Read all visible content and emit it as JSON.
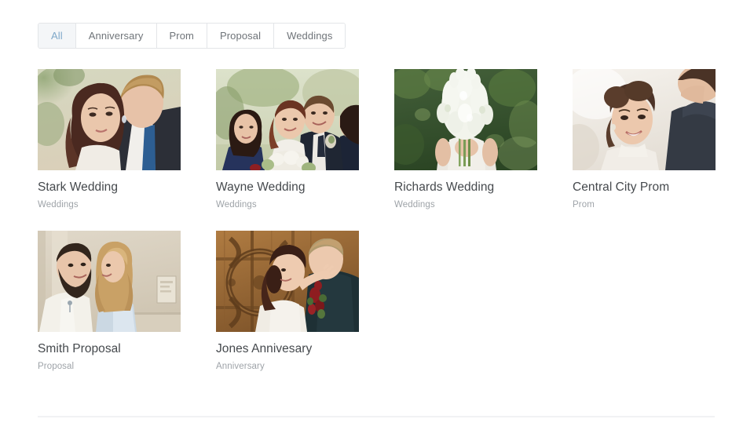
{
  "filters": {
    "tabs": [
      {
        "label": "All",
        "active": true
      },
      {
        "label": "Anniversary",
        "active": false
      },
      {
        "label": "Prom",
        "active": false
      },
      {
        "label": "Proposal",
        "active": false
      },
      {
        "label": "Weddings",
        "active": false
      }
    ]
  },
  "gallery": {
    "items": [
      {
        "title": "Stark Wedding",
        "category": "Weddings",
        "image_alt": "bride-and-groom-close-portrait",
        "colors": {
          "bg_top": "#cfd3bc",
          "bg_bottom": "#d8cdb8",
          "foliage": "#8b9d72",
          "skin": "#e8c4ab",
          "hair_dark": "#4a2a20",
          "hair_light": "#b08a54",
          "suit": "#2d3038",
          "shirt": "#f2f0ec",
          "tie": "#2e5f93"
        }
      },
      {
        "title": "Wayne Wedding",
        "category": "Weddings",
        "image_alt": "wedding-party-group-outdoors",
        "colors": {
          "bg_top": "#d6dcc4",
          "bg_bottom": "#cfd2b6",
          "foliage": "#9aab7e",
          "skin": "#e9c3a6",
          "hair_dark": "#32211b",
          "hair_red": "#7a3f28",
          "suit": "#1f2633",
          "dress_navy": "#26335c",
          "gown": "#f2efe9",
          "bouquet": "#f0ece2"
        }
      },
      {
        "title": "Richards Wedding",
        "category": "Weddings",
        "image_alt": "white-bouquet-held-by-bride",
        "colors": {
          "bg_top": "#3f5a33",
          "bg_bottom": "#2f4a28",
          "foliage": "#4c6b3a",
          "flowers": "#f3f5ee",
          "stems": "#789a55",
          "skin": "#e3bfa4",
          "dress": "#eceae4"
        }
      },
      {
        "title": "Central City Prom",
        "category": "Prom",
        "image_alt": "smiling-woman-with-updo-and-partner",
        "colors": {
          "bg_top": "#f3efe9",
          "bg_bottom": "#e8e2da",
          "skin": "#eac7ad",
          "hair_dark": "#4a3226",
          "suit": "#343a44",
          "dress": "#f0ece6"
        }
      },
      {
        "title": "Smith Proposal",
        "category": "Proposal",
        "image_alt": "couple-kissing-indoors-beige-wall",
        "colors": {
          "bg_top": "#ddd5c5",
          "bg_bottom": "#d2c8b6",
          "skin": "#e9c6ab",
          "hair_dark": "#32251c",
          "hair_blonde": "#c9a166",
          "shirt_white": "#f4f2ec",
          "shirt_blue": "#cbd8e3",
          "panel": "#e6e0d2"
        }
      },
      {
        "title": "Jones Annivesary",
        "category": "Anniversary",
        "image_alt": "couple-embracing-before-wooden-door",
        "colors": {
          "door_light": "#a9763f",
          "door_mid": "#8a5c2d",
          "door_dark": "#5e3c1c",
          "skin": "#ecc9ae",
          "hair_dark": "#3a1f16",
          "hair_light": "#c2a070",
          "suit": "#1e3035",
          "dress": "#f0ece4",
          "flowers_red": "#8e1d20",
          "leaves": "#4a6b35"
        }
      }
    ]
  },
  "theme": {
    "accent": "#7fa8c9",
    "title_color": "#45494d",
    "category_color": "#9ea3a8",
    "border_color": "#e3e5e8",
    "active_tab_bg": "#f4f6f8",
    "divider_color": "#f1f2f4",
    "page_background": "#ffffff"
  }
}
